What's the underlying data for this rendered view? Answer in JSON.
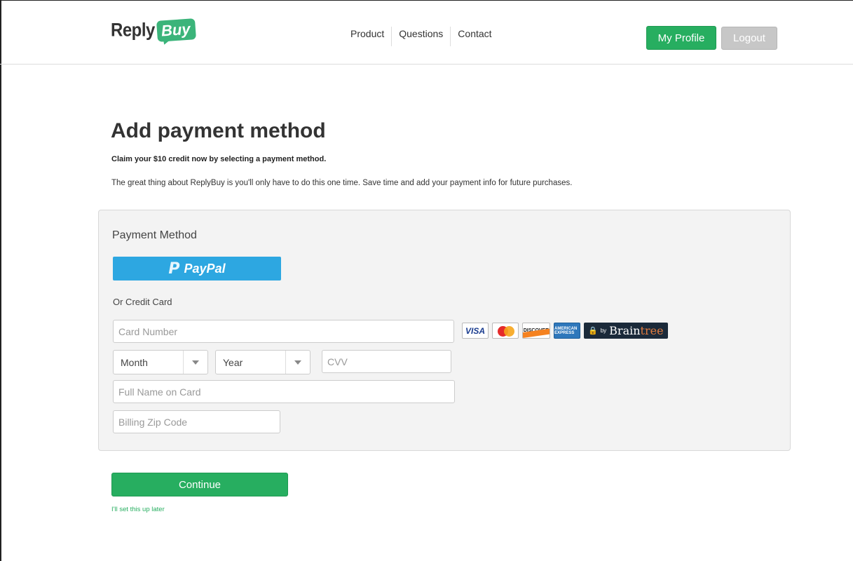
{
  "header": {
    "logo": {
      "part1": "Reply",
      "part2": "Buy"
    },
    "nav": [
      "Product",
      "Questions",
      "Contact"
    ],
    "profile_label": "My Profile",
    "logout_label": "Logout"
  },
  "intro": {
    "title": "Add payment method",
    "subtitle": "Claim your $10 credit now by selecting a payment method.",
    "description": "The great thing about ReplyBuy is you'll only have to do this one time. Save time and add your payment info for future purchases."
  },
  "payment": {
    "title": "Payment Method",
    "paypal_label": "PayPal",
    "or_credit_card": "Or Credit Card",
    "card_number_placeholder": "Card Number",
    "month_label": "Month",
    "year_label": "Year",
    "cvv_placeholder": "CVV",
    "name_placeholder": "Full Name on Card",
    "zip_placeholder": "Billing Zip Code",
    "card_logos": {
      "visa": "VISA",
      "mastercard": "MasterCard",
      "discover": "DISCOVER",
      "amex": "AMERICAN EXPRESS"
    },
    "braintree": {
      "by": "by",
      "brain": "Brain",
      "tree": "tree"
    }
  },
  "actions": {
    "continue_label": "Continue",
    "later_label": "I'll set this up later"
  },
  "colors": {
    "accent": "#27ae60",
    "paypal": "#2da7e1",
    "logout": "#c7c7c7"
  }
}
